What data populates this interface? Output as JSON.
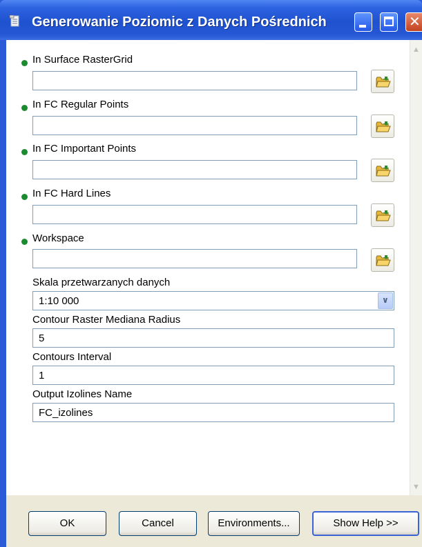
{
  "window": {
    "title": "Generowanie Poziomic z Danych Pośrednich"
  },
  "fields": {
    "surface_raster": {
      "label": "In Surface RasterGrid",
      "value": ""
    },
    "regular_points": {
      "label": "In FC Regular Points",
      "value": ""
    },
    "important_points": {
      "label": "In FC Important Points",
      "value": ""
    },
    "hard_lines": {
      "label": "In FC Hard Lines",
      "value": ""
    },
    "workspace": {
      "label": "Workspace",
      "value": ""
    },
    "scale": {
      "label": "Skala przetwarzanych danych",
      "value": "1:10 000"
    },
    "median_radius": {
      "label": "Contour Raster Mediana Radius",
      "value": "5"
    },
    "contours_interval": {
      "label": "Contours Interval",
      "value": "1"
    },
    "output_name": {
      "label": "Output Izolines Name",
      "value": "FC_izolines"
    }
  },
  "buttons": {
    "ok": "OK",
    "cancel": "Cancel",
    "environments": "Environments...",
    "show_help": "Show Help >>"
  },
  "colors": {
    "titlebar": "#2456d8",
    "required_dot": "#1a8c2e",
    "folder": "#e6b93c"
  }
}
